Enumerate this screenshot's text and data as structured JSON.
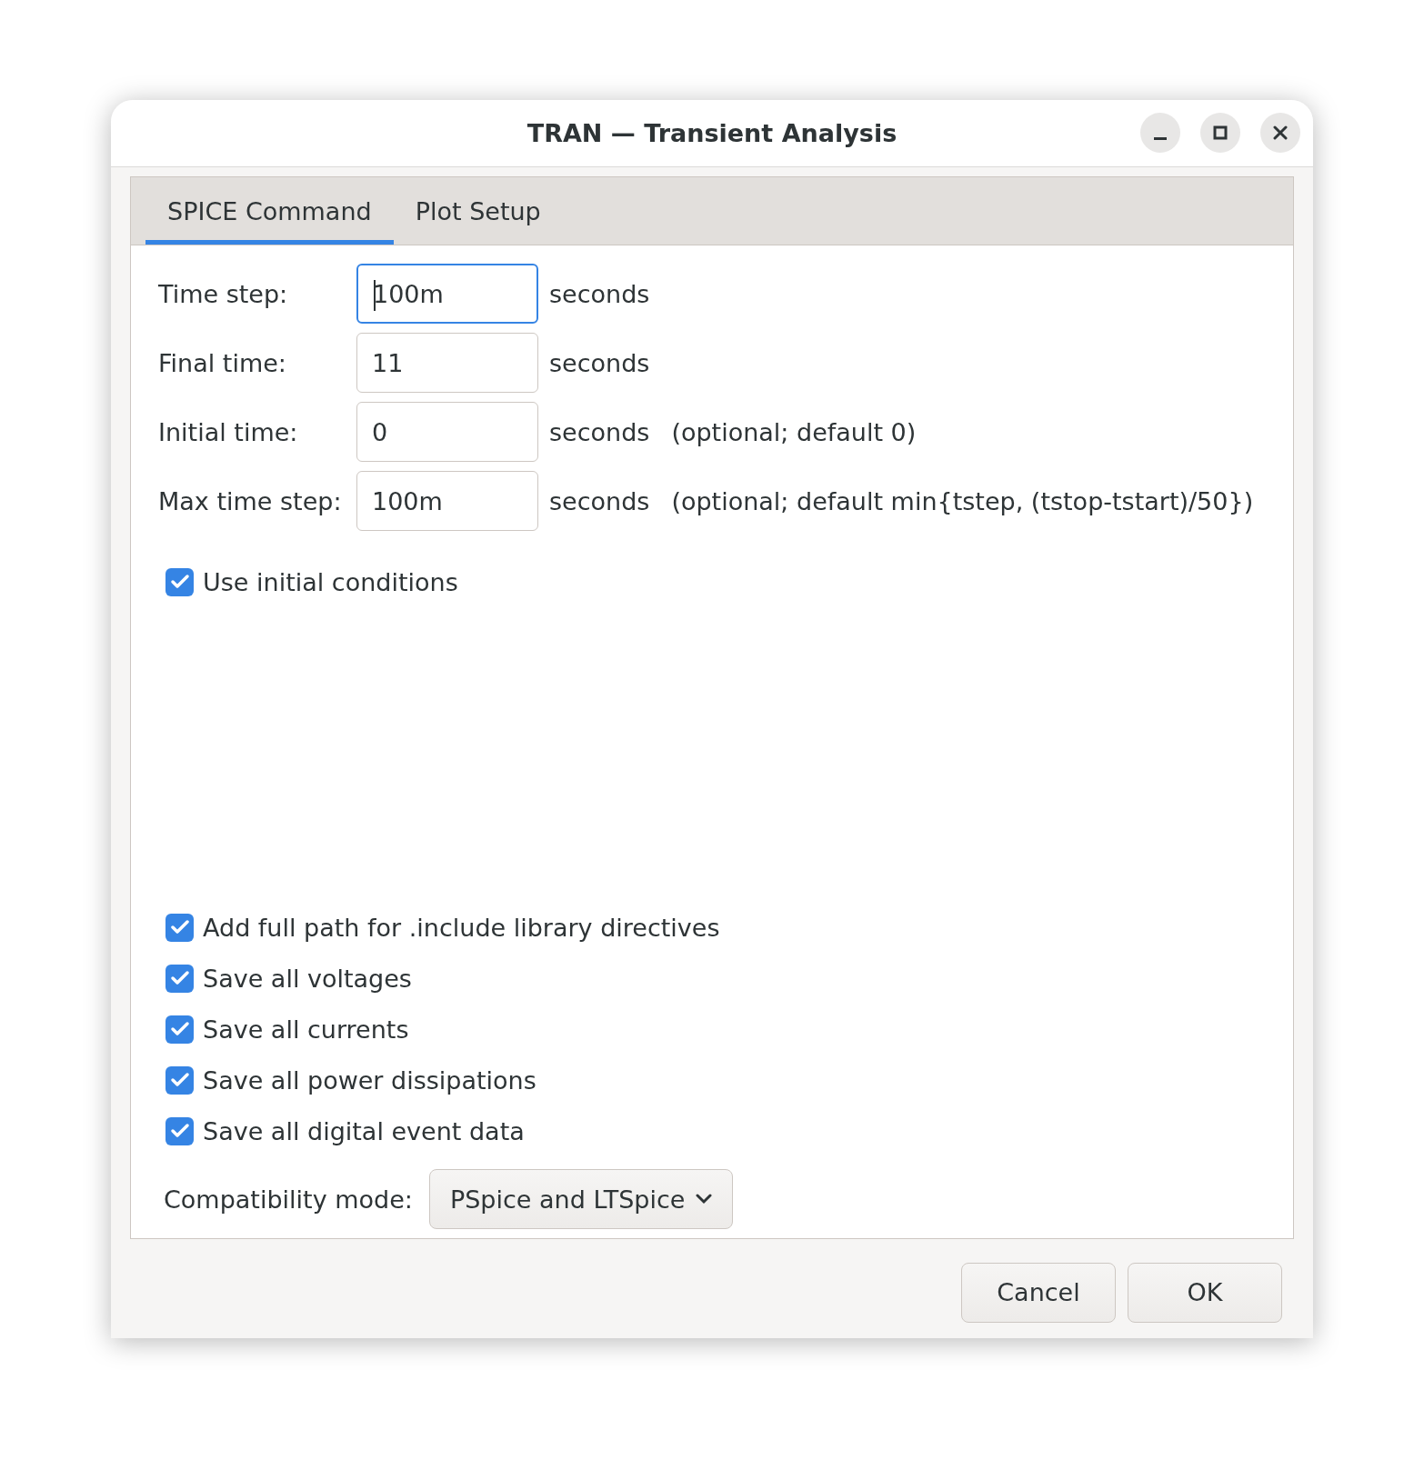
{
  "window": {
    "title": "TRAN — Transient Analysis"
  },
  "tabs": [
    {
      "label": "SPICE Command",
      "selected": true
    },
    {
      "label": "Plot Setup",
      "selected": false
    }
  ],
  "fields": [
    {
      "label": "Time step:",
      "value": "100m",
      "unit": "seconds",
      "focused": true
    },
    {
      "label": "Final time:",
      "value": "11",
      "unit": "seconds",
      "focused": false
    },
    {
      "label": "Initial time:",
      "value": "0",
      "unit": "seconds",
      "note": "(optional; default 0)",
      "focused": false
    },
    {
      "label": "Max time step:",
      "value": "100m",
      "unit": "seconds",
      "note": "(optional; default min{tstep, (tstop-tstart)/50})",
      "focused": false
    }
  ],
  "top_options": [
    {
      "label": "Use initial conditions",
      "checked": true
    }
  ],
  "bottom_options": [
    {
      "label": "Add full path for .include library directives",
      "checked": true
    },
    {
      "label": "Save all voltages",
      "checked": true
    },
    {
      "label": "Save all currents",
      "checked": true
    },
    {
      "label": "Save all power dissipations",
      "checked": true
    },
    {
      "label": "Save all digital event data",
      "checked": true
    }
  ],
  "compatibility": {
    "label": "Compatibility mode:",
    "value": "PSpice and LTSpice"
  },
  "buttons": [
    "Cancel",
    "OK"
  ]
}
